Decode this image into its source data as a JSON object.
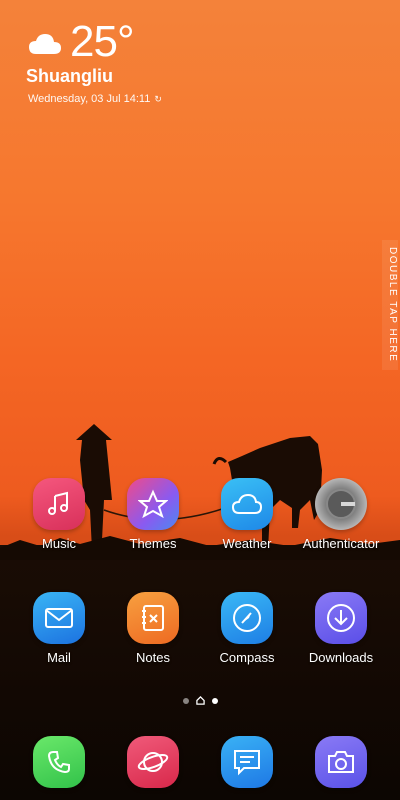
{
  "weather": {
    "temperature": "25°",
    "city": "Shuangliu",
    "date": "Wednesday, 03 Jul 14:11",
    "icon": "cloud-icon"
  },
  "side_hint": "DOUBLE TAP HERE",
  "apps_row1": [
    {
      "label": "Music",
      "icon": "music-icon"
    },
    {
      "label": "Themes",
      "icon": "themes-icon"
    },
    {
      "label": "Weather",
      "icon": "weather-app-icon"
    },
    {
      "label": "Authenticator",
      "icon": "authenticator-icon"
    }
  ],
  "apps_row2": [
    {
      "label": "Mail",
      "icon": "mail-icon"
    },
    {
      "label": "Notes",
      "icon": "notes-icon"
    },
    {
      "label": "Compass",
      "icon": "compass-icon"
    },
    {
      "label": "Downloads",
      "icon": "downloads-icon"
    }
  ],
  "dock": [
    {
      "icon": "phone-icon"
    },
    {
      "icon": "browser-icon"
    },
    {
      "icon": "messages-icon"
    },
    {
      "icon": "camera-icon"
    }
  ],
  "colors": {
    "music": "#e83a6a",
    "themes": "#6b5ff0",
    "weather": "#2aa8f0",
    "authenticator": "#9a9a9a",
    "mail": "#2a8ff0",
    "notes": "#f07a2a",
    "compass": "#2a92f0",
    "downloads": "#6a5ef0",
    "phone": "#4cd55a",
    "browser": "#e8385a",
    "messages": "#3a8ef0",
    "camera": "#6a6af0"
  }
}
